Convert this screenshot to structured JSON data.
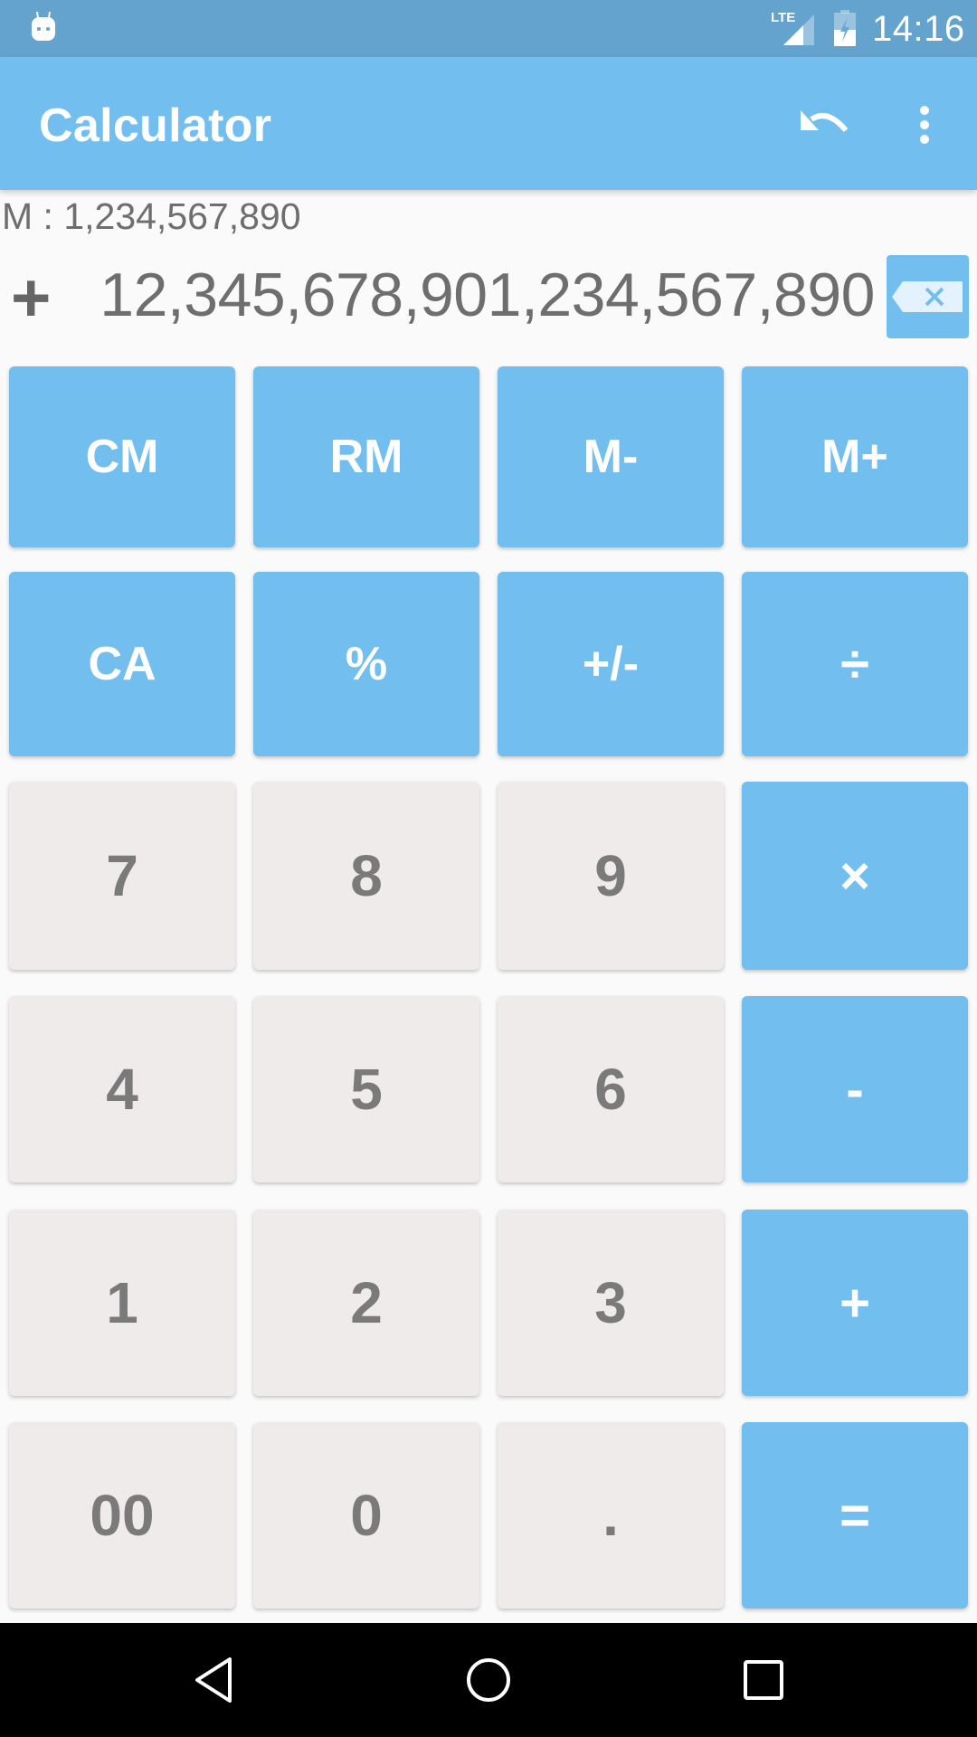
{
  "status_bar": {
    "time": "14:16",
    "network": "LTE",
    "icons": [
      "android-notification-icon",
      "lte-signal-icon",
      "battery-charging-icon"
    ]
  },
  "app_bar": {
    "title": "Calculator",
    "actions": [
      {
        "name": "undo",
        "icon": "undo-icon"
      },
      {
        "name": "more-options",
        "icon": "overflow-menu-icon"
      }
    ]
  },
  "display": {
    "memory_label": "M : 1,234,567,890",
    "operator_sign": "+",
    "value": "12,345,678,901,234,567,890",
    "backspace_icon": "backspace-icon"
  },
  "keypad": {
    "rows": [
      [
        {
          "label": "CM",
          "style": "blue",
          "name": "clear-memory"
        },
        {
          "label": "RM",
          "style": "blue",
          "name": "recall-memory"
        },
        {
          "label": "M-",
          "style": "blue",
          "name": "memory-minus"
        },
        {
          "label": "M+",
          "style": "blue",
          "name": "memory-plus"
        }
      ],
      [
        {
          "label": "CA",
          "style": "blue",
          "name": "clear-all"
        },
        {
          "label": "%",
          "style": "blue",
          "name": "percent"
        },
        {
          "label": "+/-",
          "style": "blue",
          "name": "toggle-sign"
        },
        {
          "label": "÷",
          "style": "blue",
          "name": "divide"
        }
      ],
      [
        {
          "label": "7",
          "style": "light",
          "name": "digit-7"
        },
        {
          "label": "8",
          "style": "light",
          "name": "digit-8"
        },
        {
          "label": "9",
          "style": "light",
          "name": "digit-9"
        },
        {
          "label": "×",
          "style": "blue",
          "name": "multiply"
        }
      ],
      [
        {
          "label": "4",
          "style": "light",
          "name": "digit-4"
        },
        {
          "label": "5",
          "style": "light",
          "name": "digit-5"
        },
        {
          "label": "6",
          "style": "light",
          "name": "digit-6"
        },
        {
          "label": "-",
          "style": "blue",
          "name": "subtract"
        }
      ],
      [
        {
          "label": "1",
          "style": "light",
          "name": "digit-1"
        },
        {
          "label": "2",
          "style": "light",
          "name": "digit-2"
        },
        {
          "label": "3",
          "style": "light",
          "name": "digit-3"
        },
        {
          "label": "+",
          "style": "blue",
          "name": "add"
        }
      ],
      [
        {
          "label": "00",
          "style": "light",
          "name": "double-zero"
        },
        {
          "label": "0",
          "style": "light",
          "name": "digit-0"
        },
        {
          "label": ".",
          "style": "light",
          "name": "decimal-point"
        },
        {
          "label": "=",
          "style": "blue",
          "name": "equals"
        }
      ]
    ]
  },
  "nav_bar": {
    "buttons": [
      {
        "name": "back",
        "icon": "back-triangle-icon"
      },
      {
        "name": "home",
        "icon": "home-circle-icon"
      },
      {
        "name": "recents",
        "icon": "recents-square-icon"
      }
    ]
  },
  "colors": {
    "status_bar": "#64A3CE",
    "primary": "#72BFEF",
    "key_light": "#EFEBEA",
    "key_text_dark": "#7A7A7A",
    "display_text": "#6E6E6E",
    "background": "#FAFAFA"
  }
}
